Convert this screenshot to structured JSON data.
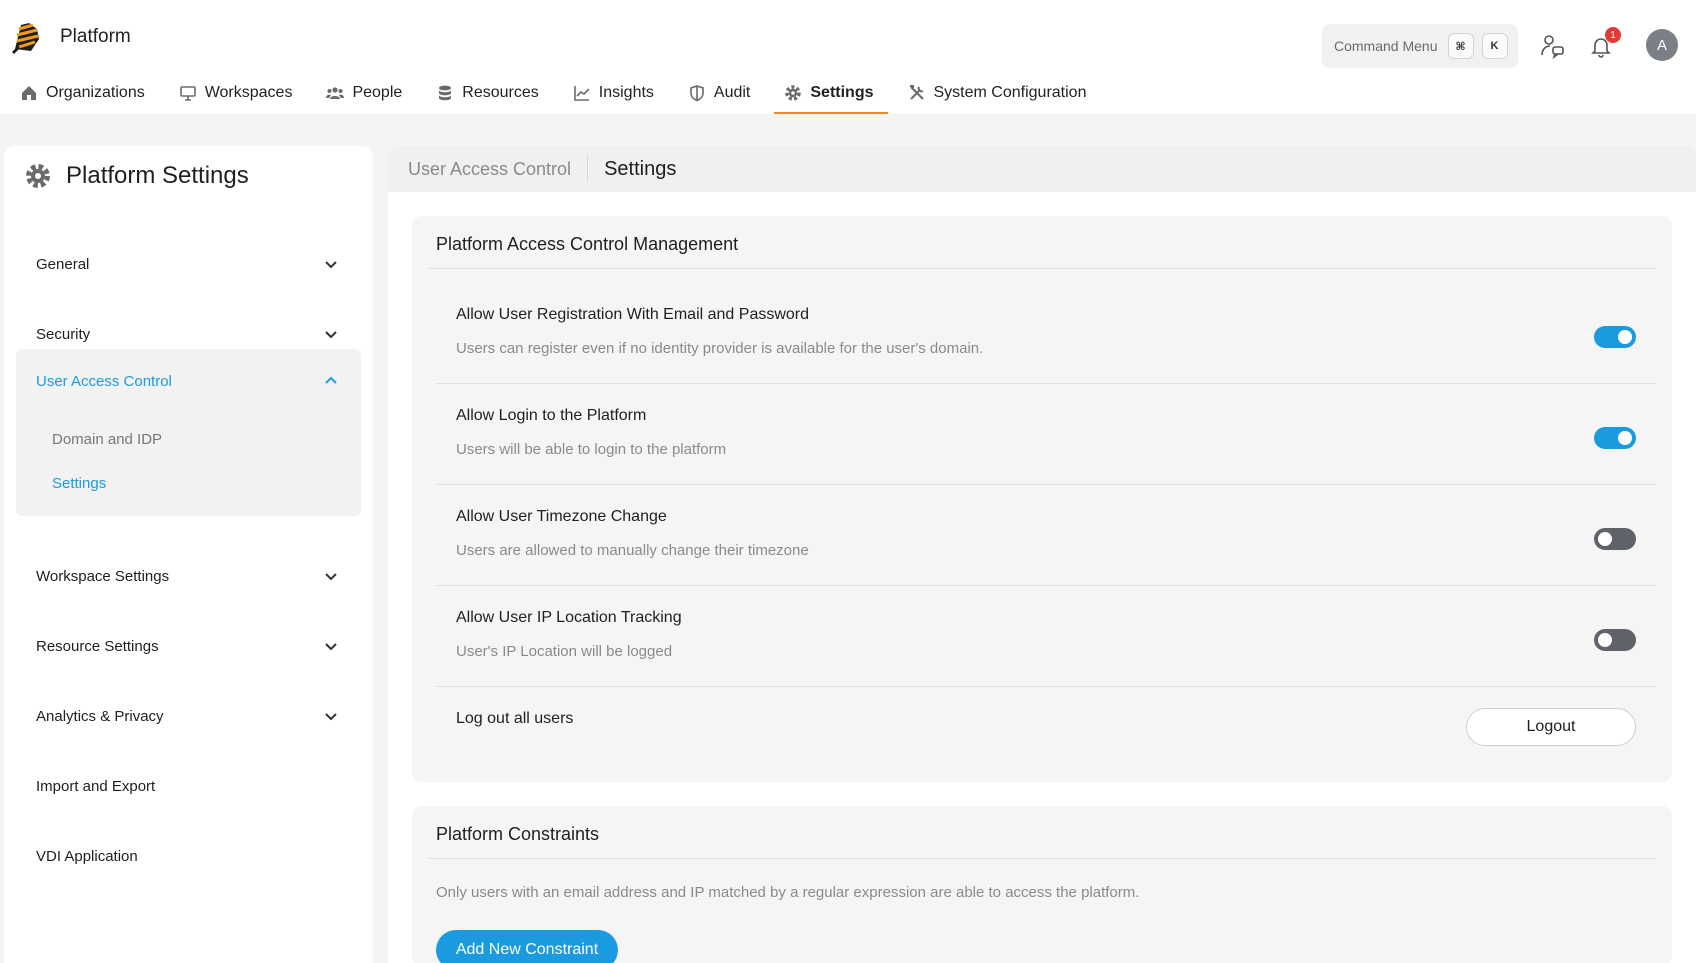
{
  "app": {
    "brand": "Platform"
  },
  "command_menu": {
    "label": "Command Menu",
    "key1": "⌘",
    "key2": "K"
  },
  "notifications": {
    "count": "1"
  },
  "user": {
    "initial": "A"
  },
  "nav": {
    "items": [
      {
        "label": "Organizations",
        "icon": "home-icon"
      },
      {
        "label": "Workspaces",
        "icon": "monitor-icon"
      },
      {
        "label": "People",
        "icon": "people-icon"
      },
      {
        "label": "Resources",
        "icon": "database-icon"
      },
      {
        "label": "Insights",
        "icon": "chart-icon"
      },
      {
        "label": "Audit",
        "icon": "shield-icon"
      },
      {
        "label": "Settings",
        "icon": "gear-icon"
      },
      {
        "label": "System Configuration",
        "icon": "tools-icon"
      }
    ],
    "active": "Settings"
  },
  "sidebar": {
    "title": "Platform Settings",
    "items": [
      {
        "label": "General"
      },
      {
        "label": "Security"
      },
      {
        "label": "User Access Control",
        "expanded": true,
        "children": [
          "Domain and IDP",
          "Settings"
        ]
      },
      {
        "label": "Workspace Settings"
      },
      {
        "label": "Resource Settings"
      },
      {
        "label": "Analytics & Privacy"
      },
      {
        "label": "Import and Export"
      },
      {
        "label": "VDI Application"
      }
    ],
    "active_child": "Settings"
  },
  "breadcrumb": {
    "parent": "User Access Control",
    "current": "Settings"
  },
  "access_card": {
    "title": "Platform Access Control Management",
    "rows": [
      {
        "title": "Allow User Registration With Email and Password",
        "desc": "Users can register even if no identity provider is available for the user's domain.",
        "enabled": true
      },
      {
        "title": "Allow Login to the Platform",
        "desc": "Users will be able to login to the platform",
        "enabled": true
      },
      {
        "title": "Allow User Timezone Change",
        "desc": "Users are allowed to manually change their timezone",
        "enabled": false
      },
      {
        "title": "Allow User IP Location Tracking",
        "desc": "User's IP Location will be logged",
        "enabled": false
      }
    ],
    "logout_row": {
      "title": "Log out all users",
      "button": "Logout"
    }
  },
  "constraints_card": {
    "title": "Platform Constraints",
    "desc": "Only users with an email address and IP matched by a regular expression are able to access the platform.",
    "button": "Add New Constraint"
  },
  "colors": {
    "accent": "#1a9be0",
    "nav_underline": "#f08a24",
    "toggle_off": "#5f6268"
  }
}
